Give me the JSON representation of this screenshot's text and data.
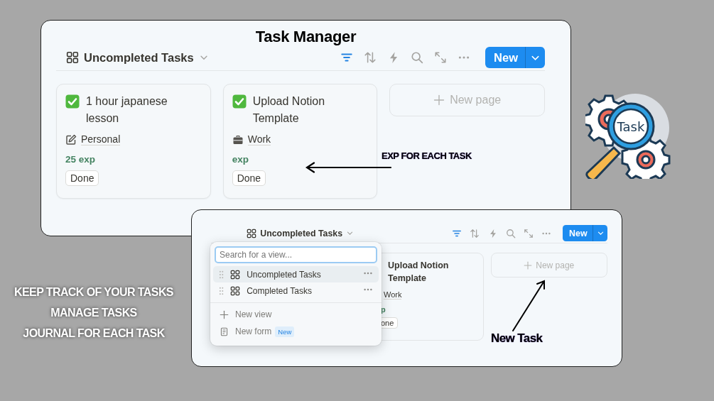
{
  "title": "Task Manager",
  "main_window": {
    "view_name": "Uncompleted Tasks",
    "new_button": "New",
    "cards": [
      {
        "title": "1 hour japanese lesson",
        "checked": true,
        "category": "Personal",
        "kind": "note",
        "exp": "25 exp",
        "status": "Done"
      },
      {
        "title": "Upload Notion Template",
        "checked": true,
        "category": "Work",
        "kind": "briefcase",
        "exp": "exp",
        "status": "Done"
      }
    ],
    "new_page": "New page"
  },
  "exp_annotation": "EXP FOR EACH TASK",
  "features": [
    "KEEP TRACK OF YOUR TASKS",
    "MANAGE TASKS",
    "JOURNAL FOR EACH TASK"
  ],
  "logo_label": "Task",
  "second_window": {
    "view_name": "Uncompleted Tasks",
    "new_button": "New",
    "card": {
      "title": "Upload Notion Template",
      "category": "Work",
      "exp": "p",
      "status": "one"
    },
    "new_page": "New page",
    "view_menu": {
      "search_placeholder": "Search for a view...",
      "views": [
        {
          "label": "Uncompleted Tasks",
          "selected": true
        },
        {
          "label": "Completed Tasks",
          "selected": false
        }
      ],
      "actions": [
        {
          "kind": "view",
          "label": "New view"
        },
        {
          "kind": "form",
          "label": "New form",
          "badge": "New"
        }
      ]
    }
  },
  "new_task_annotation": "New Task"
}
